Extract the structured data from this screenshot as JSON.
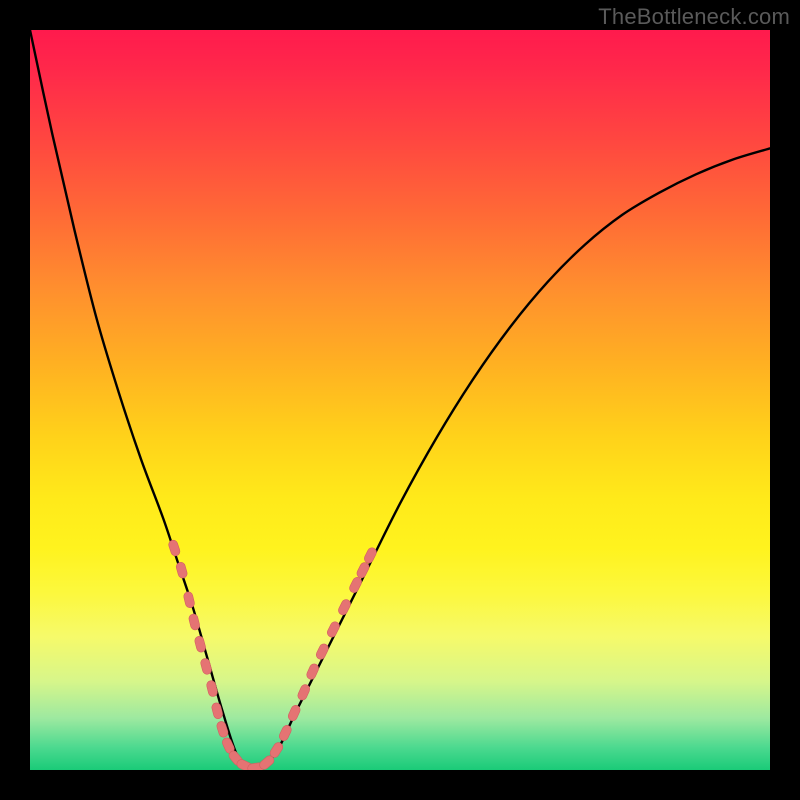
{
  "watermark": "TheBottleneck.com",
  "colors": {
    "frame": "#000000",
    "curve": "#000000",
    "marker_fill": "#e57373",
    "marker_stroke": "#d36060",
    "gradient_top": "#ff1a4d",
    "gradient_bottom": "#1acb78"
  },
  "chart_data": {
    "type": "line",
    "title": "",
    "xlabel": "",
    "ylabel": "",
    "xlim": [
      0,
      100
    ],
    "ylim": [
      0,
      100
    ],
    "grid": false,
    "legend": false,
    "note": "Single V-shaped curve over a vertical color gradient. No axis ticks or labels are visible. x and y values are read as percentages of the inner plot area (0 = left/bottom, 100 = right/top). y values estimated from pixel positions.",
    "series": [
      {
        "name": "curve",
        "x": [
          0,
          3,
          6,
          9,
          12,
          15,
          18,
          20,
          22,
          24,
          26,
          28,
          30,
          33,
          36,
          40,
          45,
          50,
          55,
          60,
          65,
          70,
          75,
          80,
          85,
          90,
          95,
          100
        ],
        "y": [
          100,
          86,
          73,
          61,
          51,
          42,
          34,
          28,
          22,
          15,
          8,
          2,
          0,
          2,
          8,
          16,
          26,
          36,
          45,
          53,
          60,
          66,
          71,
          75,
          78,
          80.5,
          82.5,
          84
        ]
      }
    ],
    "markers": {
      "note": "Rounded salmon capsules along the lower part of both branches near the dip.",
      "points": [
        {
          "x": 19.5,
          "y": 30
        },
        {
          "x": 20.5,
          "y": 27
        },
        {
          "x": 21.5,
          "y": 23
        },
        {
          "x": 22.2,
          "y": 20
        },
        {
          "x": 23.0,
          "y": 17
        },
        {
          "x": 23.8,
          "y": 14
        },
        {
          "x": 24.6,
          "y": 11
        },
        {
          "x": 25.3,
          "y": 8
        },
        {
          "x": 26.0,
          "y": 5.5
        },
        {
          "x": 26.8,
          "y": 3.3
        },
        {
          "x": 27.8,
          "y": 1.6
        },
        {
          "x": 29.0,
          "y": 0.6
        },
        {
          "x": 30.5,
          "y": 0.3
        },
        {
          "x": 32.0,
          "y": 1.0
        },
        {
          "x": 33.3,
          "y": 2.7
        },
        {
          "x": 34.5,
          "y": 5.0
        },
        {
          "x": 35.7,
          "y": 7.7
        },
        {
          "x": 37.0,
          "y": 10.5
        },
        {
          "x": 38.2,
          "y": 13.3
        },
        {
          "x": 39.5,
          "y": 16.0
        },
        {
          "x": 41.0,
          "y": 19.0
        },
        {
          "x": 42.5,
          "y": 22.0
        },
        {
          "x": 44.0,
          "y": 25.0
        },
        {
          "x": 45.0,
          "y": 27.0
        },
        {
          "x": 46.0,
          "y": 29.0
        }
      ]
    }
  }
}
